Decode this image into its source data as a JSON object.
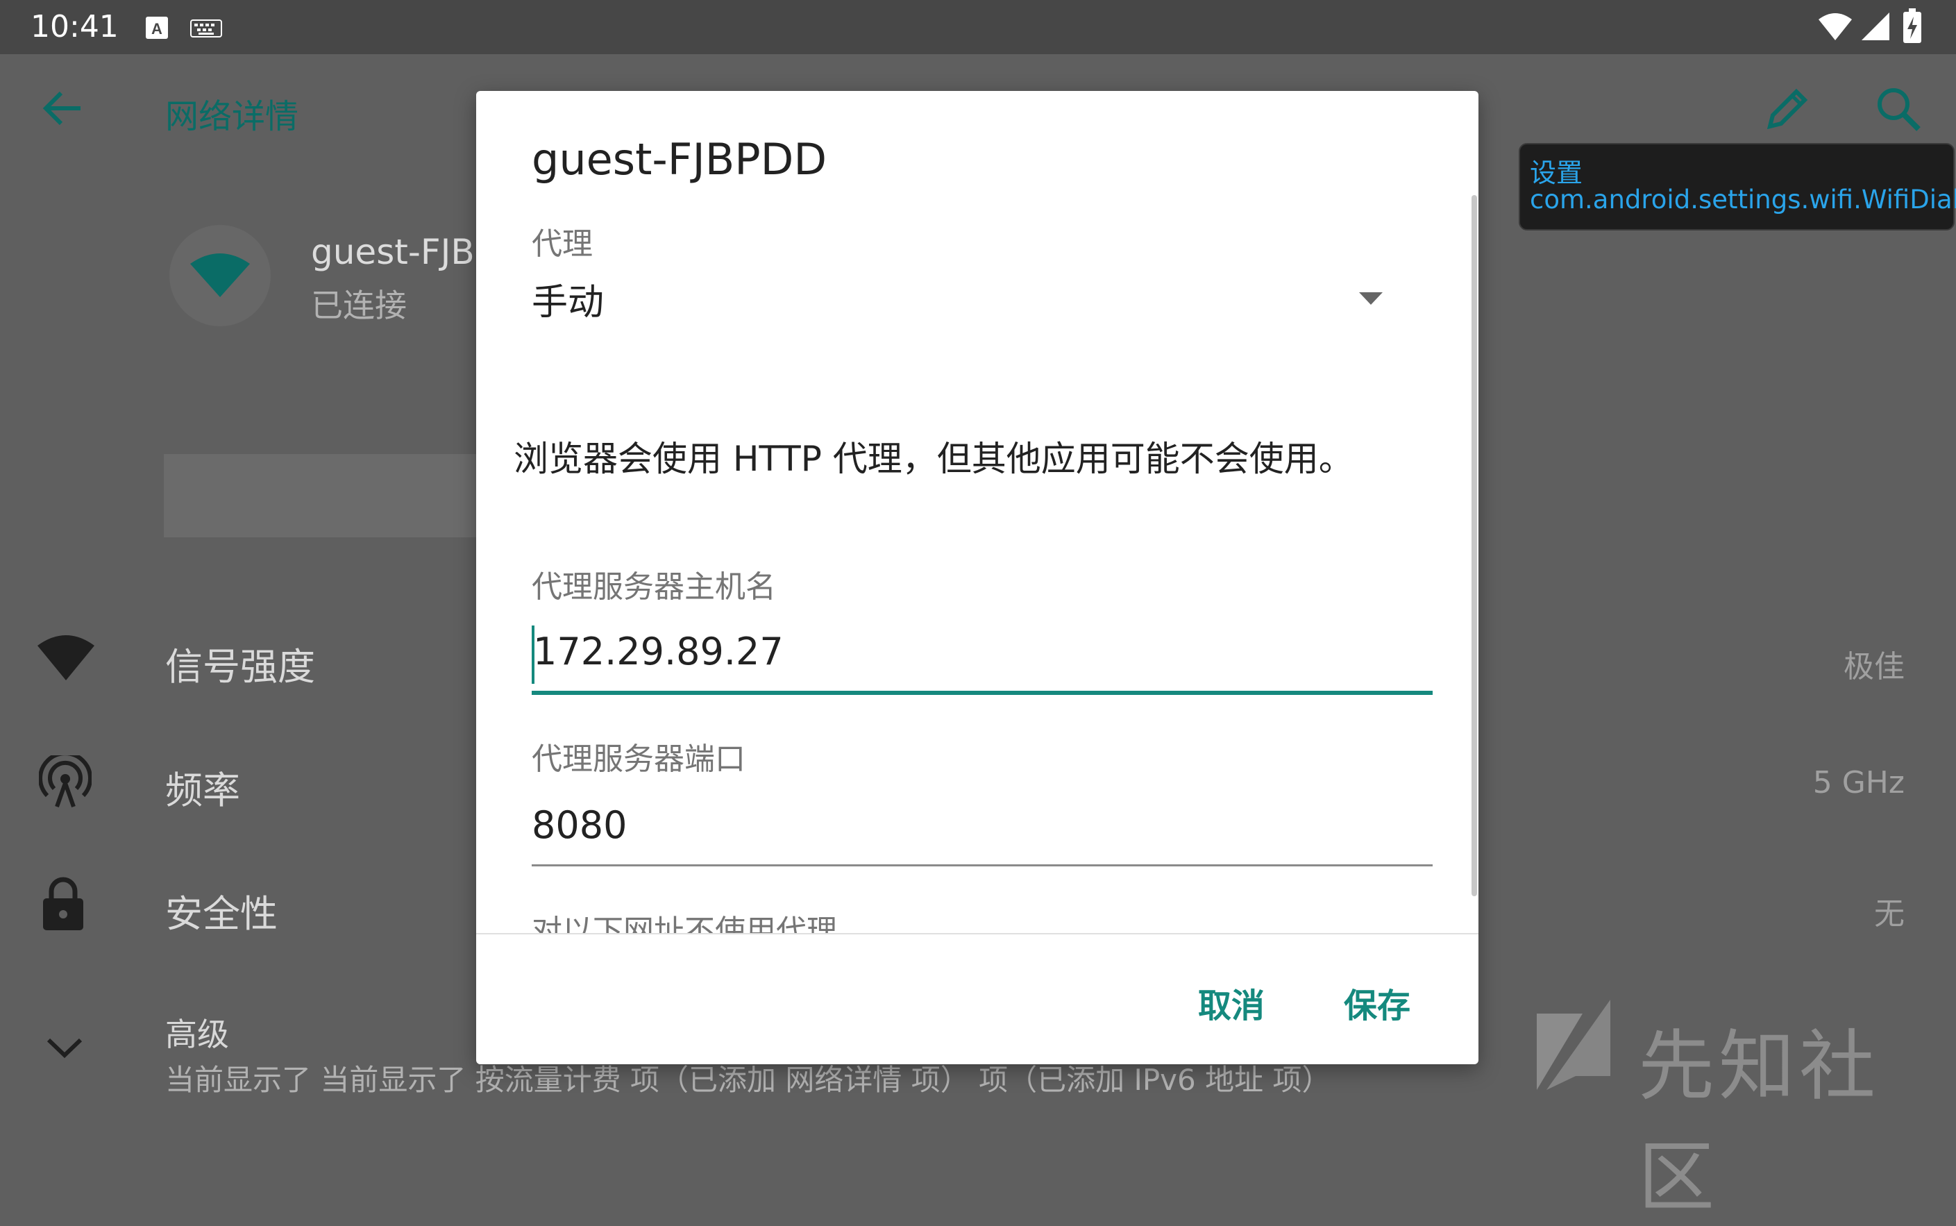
{
  "status_bar": {
    "time": "10:41",
    "icons": [
      "keyboard-a-icon",
      "keyboard-icon",
      "wifi-icon",
      "signal-icon",
      "battery-charging-icon"
    ]
  },
  "app_bar": {
    "title": "网络详情",
    "back_icon": "arrow-left-icon",
    "edit_icon": "pencil-icon",
    "search_icon": "search-icon"
  },
  "network": {
    "name_partial": "guest-FJBI",
    "status": "已连接"
  },
  "details": [
    {
      "label": "信号强度",
      "value": "极佳",
      "icon": "wifi-icon"
    },
    {
      "label": "频率",
      "value": "5 GHz",
      "icon": "antenna-icon"
    },
    {
      "label": "安全性",
      "value": "无",
      "icon": "lock-icon"
    }
  ],
  "advanced": {
    "label": "高级",
    "summary": "当前显示了 当前显示了 按流量计费 项（已添加 网络详情 项） 项（已添加 IPv6 地址 项）"
  },
  "dialog": {
    "title": "guest-FJBPDD",
    "proxy_label": "代理",
    "proxy_value": "手动",
    "warning": "浏览器会使用 HTTP 代理，但其他应用可能不会使用。",
    "host_label": "代理服务器主机名",
    "host_value": "172.29.89.27",
    "port_label": "代理服务器端口",
    "port_value": "8080",
    "bypass_label": "对以下网址不使用代理",
    "cancel_label": "取消",
    "save_label": "保存"
  },
  "tooltip": {
    "line1": "设置",
    "line2": "com.android.settings.wifi.WifiDialog"
  },
  "watermark": {
    "text": "先知社区"
  },
  "colors": {
    "accent": "#15897e",
    "scrim_bg": "#5f5f5f",
    "tooltip_text": "#2aa4ea"
  }
}
